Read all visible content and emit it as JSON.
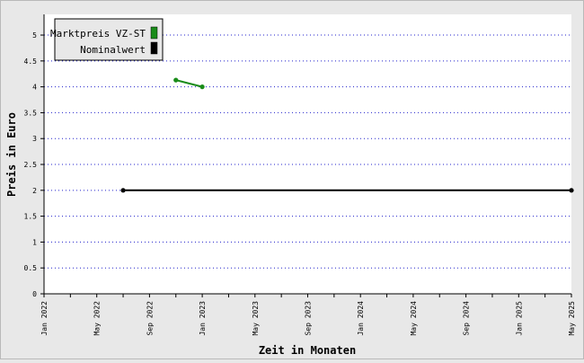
{
  "chart_data": {
    "type": "line",
    "title": "",
    "xlabel": "Zeit in Monaten",
    "ylabel": "Preis in Euro",
    "xlim": [
      "2022-01",
      "2025-05"
    ],
    "ylim": [
      0,
      5.4
    ],
    "y_ticks": [
      "0",
      "0.5",
      "1",
      "1.5",
      "2",
      "2.5",
      "3",
      "3.5",
      "4",
      "4.5",
      "5"
    ],
    "x_ticks": [
      "Jan 2022",
      "May 2022",
      "Sep 2022",
      "Jan 2023",
      "May 2023",
      "Sep 2023",
      "Jan 2024",
      "May 2024",
      "Sep 2024",
      "Jan 2025",
      "May 2025"
    ],
    "grid": "horizontal dotted",
    "legend_position": "top-left",
    "series": [
      {
        "name": "Marktpreis VZ-ST",
        "color": "#1a8c1a",
        "points": [
          {
            "x": "2022-11",
            "y": 4.13
          },
          {
            "x": "2023-01",
            "y": 4.0
          }
        ]
      },
      {
        "name": "Nominalwert",
        "color": "#000000",
        "points": [
          {
            "x": "2022-07",
            "y": 2.0
          },
          {
            "x": "2025-05",
            "y": 2.0
          }
        ]
      }
    ]
  }
}
